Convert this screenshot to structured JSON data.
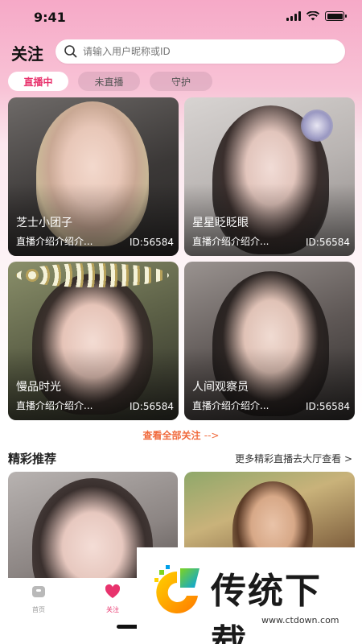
{
  "status_bar": {
    "time": "9:41"
  },
  "header": {
    "title": "关注",
    "search_placeholder": "请输入用户昵称或ID"
  },
  "tabs": [
    {
      "label": "直播中",
      "active": true
    },
    {
      "label": "未直播",
      "active": false
    },
    {
      "label": "守护",
      "active": false
    }
  ],
  "live_cards": [
    {
      "name": "芝士小团子",
      "intro": "直播介绍介绍介...",
      "id": "ID:56584"
    },
    {
      "name": "星星眨眨眼",
      "intro": "直播介绍介绍介...",
      "id": "ID:56584"
    },
    {
      "name": "慢品时光",
      "intro": "直播介绍介绍介...",
      "id": "ID:56584"
    },
    {
      "name": "人间观察员",
      "intro": "直播介绍介绍介...",
      "id": "ID:56584"
    }
  ],
  "see_all": {
    "label": "查看全部关注",
    "arrow": "-->"
  },
  "recommend": {
    "title": "精彩推荐",
    "more_label": "更多精彩直播去大厅查看 >"
  },
  "bottom_nav": [
    {
      "label": "首页",
      "icon": "home-icon"
    },
    {
      "label": "关注",
      "icon": "heart-icon"
    }
  ],
  "watermark": {
    "brand": "传统下载",
    "url": "www.ctdown.com"
  },
  "colors": {
    "accent": "#e8336d",
    "see_all": "#f06a3c"
  }
}
